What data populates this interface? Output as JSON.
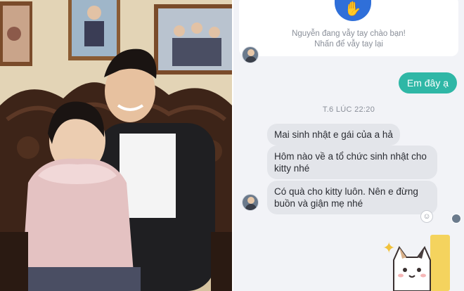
{
  "photo": {
    "description_icon": "photo-scene"
  },
  "wave_notice": {
    "icon": "waving-hand-icon",
    "line1": "Nguyễn đang vẫy tay chào bạn!",
    "line2": "Nhấn để vẫy tay lại"
  },
  "messages_out": [
    {
      "text": "Em đây ạ"
    }
  ],
  "time_separator": "T.6 LÚC 22:20",
  "messages_in": [
    {
      "text": "Mai sinh nhật e gái của a hả"
    },
    {
      "text": "Hôm nào về a tổ chức sinh nhật cho kitty nhé"
    },
    {
      "text": "Có quà cho kitty luôn. Nên e đừng buồn và giận mẹ nhé"
    }
  ],
  "reaction_icon": "add-reaction-icon",
  "sticker_icon": "cat-sticker-icon",
  "colors": {
    "outgoing_bubble": "#2fb7a6",
    "incoming_bubble": "#e3e5ea",
    "chat_background": "#f2f3f7",
    "wave_badge": "#2f6fd9"
  }
}
